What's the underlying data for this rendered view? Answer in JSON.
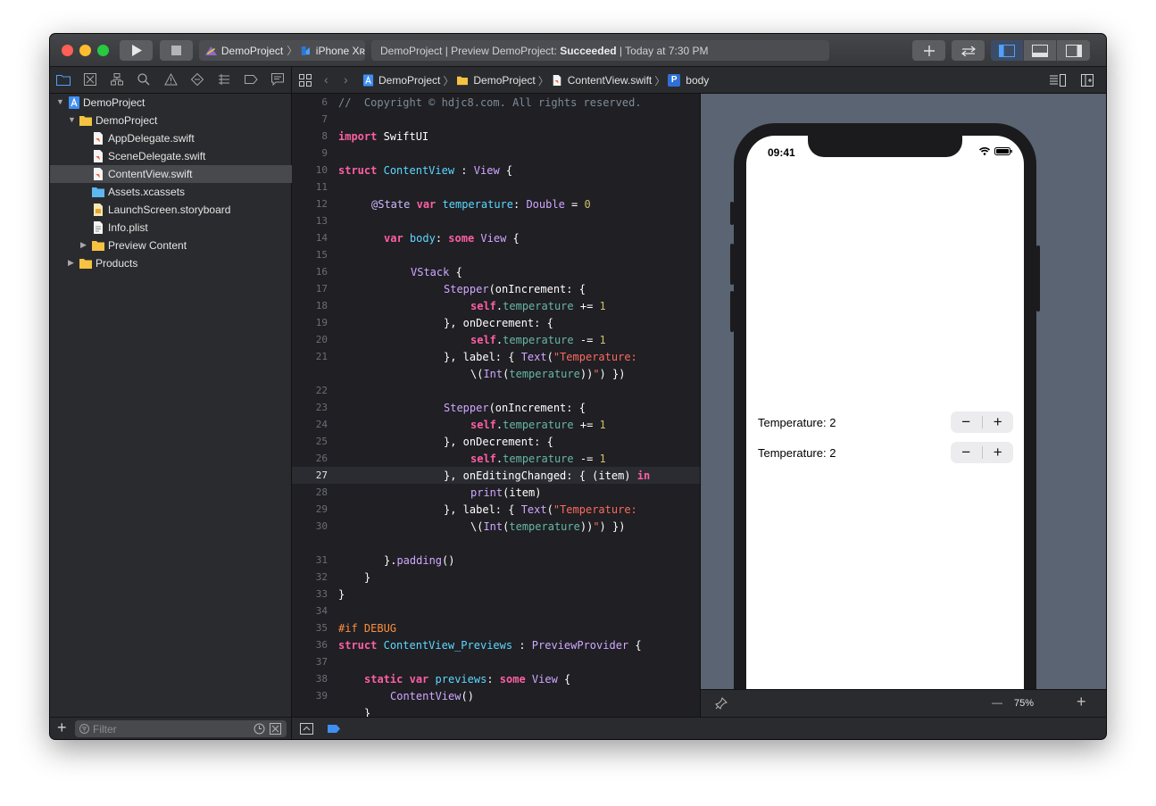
{
  "toolbar": {
    "scheme_name": "DemoProject",
    "device_name": "iPhone Xʀ",
    "status_prefix": "DemoProject | Preview DemoProject:",
    "status_result": "Succeeded",
    "status_time": "| Today at 7:30 PM",
    "colors": {
      "close": "#fe5f57",
      "minimize": "#febc2e",
      "zoom": "#28c840"
    }
  },
  "navigator": {
    "tree": [
      {
        "label": "DemoProject",
        "icon": "xcode-project-icon"
      },
      {
        "label": "DemoProject",
        "icon": "folder-icon"
      },
      {
        "label": "AppDelegate.swift",
        "icon": "swift-file-icon"
      },
      {
        "label": "SceneDelegate.swift",
        "icon": "swift-file-icon"
      },
      {
        "label": "ContentView.swift",
        "icon": "swift-file-icon",
        "selected": true
      },
      {
        "label": "Assets.xcassets",
        "icon": "asset-catalog-icon"
      },
      {
        "label": "LaunchScreen.storyboard",
        "icon": "storyboard-icon"
      },
      {
        "label": "Info.plist",
        "icon": "plist-icon"
      },
      {
        "label": "Preview Content",
        "icon": "folder-icon"
      },
      {
        "label": "Products",
        "icon": "folder-icon"
      }
    ],
    "filter_placeholder": "Filter"
  },
  "jumpbar": {
    "crumbs": [
      "DemoProject",
      "DemoProject",
      "ContentView.swift",
      "body"
    ]
  },
  "editor": {
    "current_line": "27",
    "line_numbers": [
      "6",
      "7",
      "8",
      "9",
      "10",
      "11",
      "12",
      "13",
      "14",
      "15",
      "16",
      "17",
      "18",
      "19",
      "20",
      "21",
      "22",
      "23",
      "24",
      "25",
      "26",
      "27",
      "28",
      "29",
      "30",
      "31",
      "32",
      "33",
      "34",
      "35",
      "36",
      "37",
      "38",
      "39"
    ],
    "code": {
      "l6": "//  Copyright © hdjc8.com. All rights reserved.",
      "import_kw": "import",
      "import_mod": " SwiftUI",
      "struct_kw": "struct",
      "struct_name": "ContentView",
      "conform_sep": " : ",
      "view_type": "View",
      "open_brace": " {",
      "state_attr": "@State",
      "var_kw": "var",
      "temperature": "temperature",
      "type_colon": ": ",
      "double_type": "Double",
      "assign": " = ",
      "zero": "0",
      "body": "body",
      "colon": ": ",
      "some_kw": "some",
      "vstack": "VStack",
      "stepper": "Stepper",
      "on_increment": "(onIncrement: {",
      "self_kw": "self",
      "plus_eq": " += ",
      "minus_eq": " -= ",
      "one": "1",
      "on_decrement": "}, onDecrement: {",
      "label_open": "}, label: { ",
      "text_type": "Text",
      "paren_open": "(",
      "str_temperature": "\"Temperature:",
      "str_interp": "\\(",
      "int_type": "Int",
      "close_interp": "))",
      "str_end": ")\"",
      "close_call": ") })",
      "on_editing": "}, onEditingChanged: { (item) ",
      "in_kw": "in",
      "print_fn": "print",
      "item_arg": "(item)",
      "close_brace": "}",
      "dot": "}.",
      "padding_fn": "padding",
      "empty_parens": "()",
      "if_debug": "#if DEBUG",
      "previews_struct": "ContentView_Previews",
      "preview_provider": "PreviewProvider",
      "static_kw": "static",
      "previews": "previews",
      "content_view_call": "ContentView",
      "dot_prop": "."
    }
  },
  "preview": {
    "status_time": "09:41",
    "rows": [
      {
        "label": "Temperature: 2",
        "minus": "−",
        "plus": "+"
      },
      {
        "label": "Temperature: 2",
        "minus": "−",
        "plus": "+"
      }
    ],
    "zoom": "75%",
    "zoom_minus": "—",
    "zoom_plus": "+"
  }
}
